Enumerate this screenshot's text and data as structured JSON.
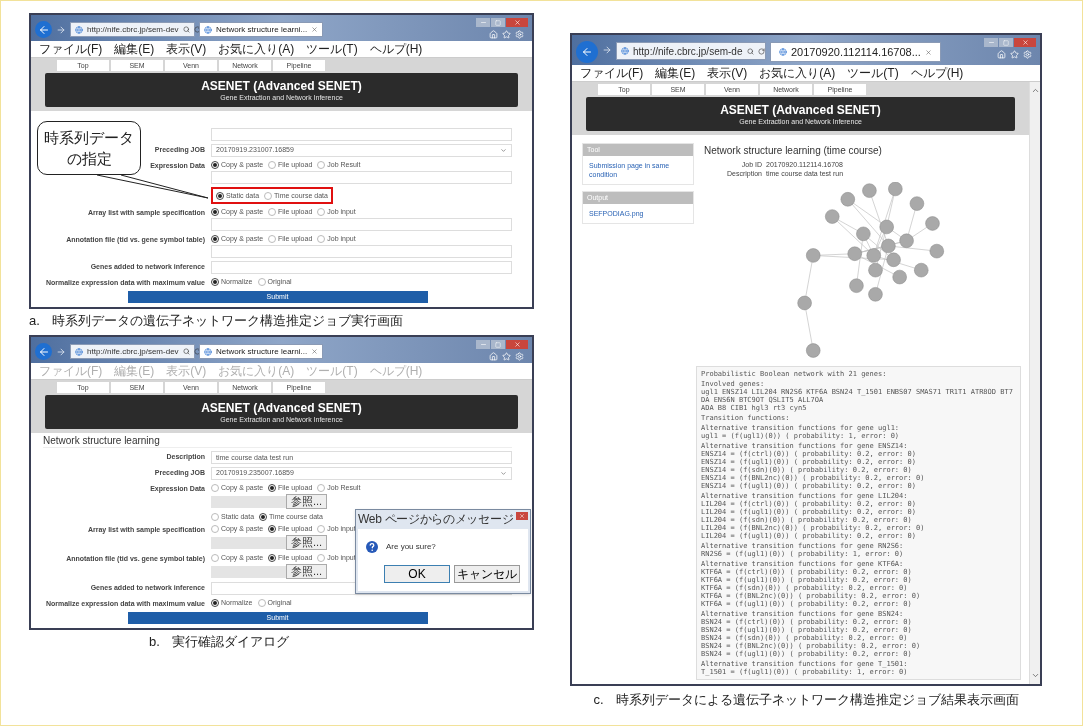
{
  "panels": [
    {
      "kind": "form",
      "caption_letter": "a.",
      "caption": "時系列データの遺伝子ネットワーク構造推定ジョブ実行画面",
      "browser": {
        "url": "http://nife.cbrc.jp/sem-dev",
        "tab_title": "Network structure learni...",
        "menu": [
          "ファイル(F)",
          "編集(E)",
          "表示(V)",
          "お気に入り(A)",
          "ツール(T)",
          "ヘルプ(H)"
        ],
        "menu_dimmed": false
      },
      "nav": [
        "Top",
        "SEM",
        "Venn",
        "Network",
        "Pipeline"
      ],
      "banner": {
        "title": "ASENET (Advanced SENET)",
        "subtitle": "Gene Extraction and Network Inference"
      },
      "callout": {
        "text": "時系列データの指定"
      },
      "form": {
        "rows": [
          {
            "kind": "text"
          },
          {
            "kind": "select",
            "label": "Preceding JOB",
            "value": "20170919.231007.16859"
          },
          {
            "kind": "radio",
            "label": "Expression Data",
            "options": [
              {
                "label": "Copy & paste",
                "selected": true
              },
              {
                "label": "File upload",
                "selected": false
              },
              {
                "label": "Job Result",
                "selected": false
              }
            ],
            "textbox": true
          },
          {
            "kind": "radio",
            "highlight": true,
            "options": [
              {
                "label": "Static data",
                "selected": true
              },
              {
                "label": "Time course data",
                "selected": false
              }
            ]
          },
          {
            "kind": "radio",
            "label": "Array list with sample specification",
            "options": [
              {
                "label": "Copy & paste",
                "selected": true
              },
              {
                "label": "File upload",
                "selected": false
              },
              {
                "label": "Job input",
                "selected": false
              }
            ],
            "textbox": true
          },
          {
            "kind": "radio",
            "label": "Annotation file (tid vs. gene symbol table)",
            "options": [
              {
                "label": "Copy & paste",
                "selected": true
              },
              {
                "label": "File upload",
                "selected": false
              },
              {
                "label": "Job input",
                "selected": false
              }
            ],
            "textbox": true
          },
          {
            "kind": "text",
            "label": "Genes added to network inference"
          },
          {
            "kind": "radio",
            "label": "Normalize expression data with maximum value",
            "options": [
              {
                "label": "Normalize",
                "selected": true
              },
              {
                "label": "Original",
                "selected": false
              }
            ]
          }
        ],
        "submit": "Submit"
      }
    },
    {
      "kind": "form",
      "caption_letter": "b.",
      "caption": "実行確認ダイアログ",
      "browser": {
        "url": "http://nife.cbrc.jp/sem-dev",
        "tab_title": "Network structure learni...",
        "menu": [
          "ファイル(F)",
          "編集(E)",
          "表示(V)",
          "お気に入り(A)",
          "ツール(T)",
          "ヘルプ(H)"
        ],
        "menu_dimmed": true
      },
      "nav": [
        "Top",
        "SEM",
        "Venn",
        "Network",
        "Pipeline"
      ],
      "banner": {
        "title": "ASENET (Advanced SENET)",
        "subtitle": "Gene Extraction and Network Inference"
      },
      "form": {
        "heading": "Network structure learning",
        "rows": [
          {
            "kind": "text",
            "label": "Description",
            "value": "time course data test run"
          },
          {
            "kind": "select",
            "label": "Preceding JOB",
            "value": "20170919.235007.16859"
          },
          {
            "kind": "radio",
            "label": "Expression Data",
            "options": [
              {
                "label": "Copy & paste",
                "selected": false
              },
              {
                "label": "File upload",
                "selected": true
              },
              {
                "label": "Job Result",
                "selected": false
              }
            ],
            "file_button": "参照..."
          },
          {
            "kind": "radio",
            "options": [
              {
                "label": "Static data",
                "selected": false
              },
              {
                "label": "Time course data",
                "selected": true
              }
            ]
          },
          {
            "kind": "radio",
            "label": "Array list with sample specification",
            "options": [
              {
                "label": "Copy & paste",
                "selected": false
              },
              {
                "label": "File upload",
                "selected": true
              },
              {
                "label": "Job input",
                "selected": false
              }
            ],
            "file_button": "参照..."
          },
          {
            "kind": "radio",
            "label": "Annotation file (tid vs. gene symbol table)",
            "options": [
              {
                "label": "Copy & paste",
                "selected": false
              },
              {
                "label": "File upload",
                "selected": true
              },
              {
                "label": "Job input",
                "selected": false
              }
            ],
            "file_button": "参照..."
          },
          {
            "kind": "text",
            "label": "Genes added to network inference"
          },
          {
            "kind": "radio",
            "label": "Normalize expression data with maximum value",
            "options": [
              {
                "label": "Normalize",
                "selected": true
              },
              {
                "label": "Original",
                "selected": false
              }
            ]
          }
        ],
        "submit": "Submit"
      },
      "dialog": {
        "title": "Web ページからのメッセージ",
        "message": "Are you sure?",
        "buttons": [
          "OK",
          "キャンセル"
        ]
      }
    },
    {
      "kind": "result",
      "caption_letter": "c.",
      "caption": "時系列データによる遺伝子ネットワーク構造推定ジョブ結果表示画面",
      "browser": {
        "url": "http://nife.cbrc.jp/sem-de",
        "tab_title": "20170920.112114.16708...",
        "menu": [
          "ファイル(F)",
          "編集(E)",
          "表示(V)",
          "お気に入り(A)",
          "ツール(T)",
          "ヘルプ(H)"
        ],
        "menu_dimmed": false
      },
      "nav": [
        "Top",
        "SEM",
        "Venn",
        "Network",
        "Pipeline"
      ],
      "banner": {
        "title": "ASENET (Advanced SENET)",
        "subtitle": "Gene Extraction and Network Inference"
      },
      "sidebar": [
        {
          "heading": "Tool",
          "links": [
            "Submission page in same condition"
          ]
        },
        {
          "heading": "Output",
          "links": [
            "SEFPODIAG.png"
          ]
        }
      ],
      "title": "Network structure learning (time course)",
      "fields": [
        {
          "label": "Job ID",
          "value": "20170920.112114.16708"
        },
        {
          "label": "Description",
          "value": "time course data test run"
        }
      ],
      "code_blocks": [
        [
          "Probabilistic Boolean network with 21 genes:"
        ],
        [
          "Involved genes:",
          "ugl1 ENSZ14 LIL204 RN2S6 KTF6A BSN24 T_1501 ENBS07 SMAS71 TR1T1 ATR8OD BT7DA ENS6N BTC9OT QSLIT5 ALL7OA",
          "ADA B8 CIB1 hgl3 rt3 cyn5"
        ],
        [
          "Transition functions:"
        ],
        [
          "Alternative transition functions for gene ugl1:",
          "ugl1 = (f(ugl1)(0)) ( probability: 1, error: 0)"
        ],
        [
          "Alternative transition functions for gene ENSZ14:",
          "ENSZ14 = (f(ctrl)(0)) ( probability: 0.2, error: 0)",
          "ENSZ14 = (f(ugl1)(0)) ( probability: 0.2, error: 0)",
          "ENSZ14 = (f(sdn)(0)) ( probability: 0.2, error: 0)",
          "ENSZ14 = (f(BNL2nc)(0)) ( probability: 0.2, error: 0)",
          "ENSZ14 = (f(ugl1)(0)) ( probability: 0.2, error: 0)"
        ],
        [
          "Alternative transition functions for gene LIL204:",
          "LIL204 = (f(ctrl)(0)) ( probability: 0.2, error: 0)",
          "LIL204 = (f(ugl1)(0)) ( probability: 0.2, error: 0)",
          "LIL204 = (f(sdn)(0)) ( probability: 0.2, error: 0)",
          "LIL204 = (f(BNL2nc)(0)) ( probability: 0.2, error: 0)",
          "LIL204 = (f(ugl1)(0)) ( probability: 0.2, error: 0)"
        ],
        [
          "Alternative transition functions for gene RN2S6:",
          "RN2S6 = (f(ugl1)(0)) ( probability: 1, error: 0)"
        ],
        [
          "Alternative transition functions for gene KTF6A:",
          "KTF6A = (f(ctrl)(0)) ( probability: 0.2, error: 0)",
          "KTF6A = (f(ugl1)(0)) ( probability: 0.2, error: 0)",
          "KTF6A = (f(sdn)(0)) ( probability: 0.2, error: 0)",
          "KTF6A = (f(BNL2nc)(0)) ( probability: 0.2, error: 0)",
          "KTF6A = (f(ugl1)(0)) ( probability: 0.2, error: 0)"
        ],
        [
          "Alternative transition functions for gene BSN24:",
          "BSN24 = (f(ctrl)(0)) ( probability: 0.2, error: 0)",
          "BSN24 = (f(ugl1)(0)) ( probability: 0.2, error: 0)",
          "BSN24 = (f(sdn)(0)) ( probability: 0.2, error: 0)",
          "BSN24 = (f(BNL2nc)(0)) ( probability: 0.2, error: 0)",
          "BSN24 = (f(ugl1)(0)) ( probability: 0.2, error: 0)"
        ],
        [
          "Alternative transition functions for gene T_1501:",
          "T_1501 = (f(ugl1)(0)) ( probability: 1, error: 0)"
        ]
      ]
    }
  ]
}
